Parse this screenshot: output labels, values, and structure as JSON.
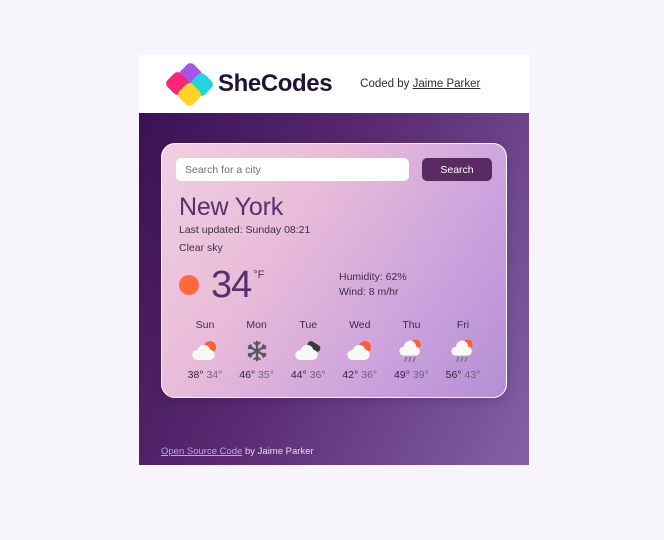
{
  "header": {
    "logo_word": "SheCodes",
    "logo_icon": "shecodes-diamond-logo",
    "coded_by_prefix": "Coded by ",
    "author_name": "Jaime Parker"
  },
  "search": {
    "placeholder": "Search for a city",
    "value": "",
    "button_label": "Search"
  },
  "current": {
    "city": "New York",
    "last_updated": "Last updated: Sunday 08:21",
    "condition": "Clear sky",
    "icon": "sun-icon",
    "temperature": "34",
    "unit": "°F",
    "humidity": "Humidity: 62%",
    "wind": "Wind: 8 m/hr"
  },
  "forecast": [
    {
      "day": "Sun",
      "icon": "sun-behind-cloud-icon",
      "high": "38°",
      "low": "34°"
    },
    {
      "day": "Mon",
      "icon": "snowflake-icon",
      "high": "46°",
      "low": "35°"
    },
    {
      "day": "Tue",
      "icon": "cloud-dark-icon",
      "high": "44°",
      "low": "36°"
    },
    {
      "day": "Wed",
      "icon": "sun-behind-cloud-icon",
      "high": "42°",
      "low": "36°"
    },
    {
      "day": "Thu",
      "icon": "sun-behind-rain-cloud-icon",
      "high": "49°",
      "low": "39°"
    },
    {
      "day": "Fri",
      "icon": "sun-behind-rain-cloud-icon",
      "high": "56°",
      "low": "43°"
    }
  ],
  "footer": {
    "link_label": "Open Source Code",
    "suffix": " by Jaime Parker"
  },
  "colors": {
    "accent_purple": "#5b2a63",
    "sun_orange": "#ff6a3d",
    "city_text": "#58306b",
    "logo_purple": "#a855e6",
    "logo_pink": "#fb2576",
    "logo_cyan": "#22d3e0",
    "logo_yellow": "#ffd325",
    "page_background": "#f7f5fb"
  }
}
